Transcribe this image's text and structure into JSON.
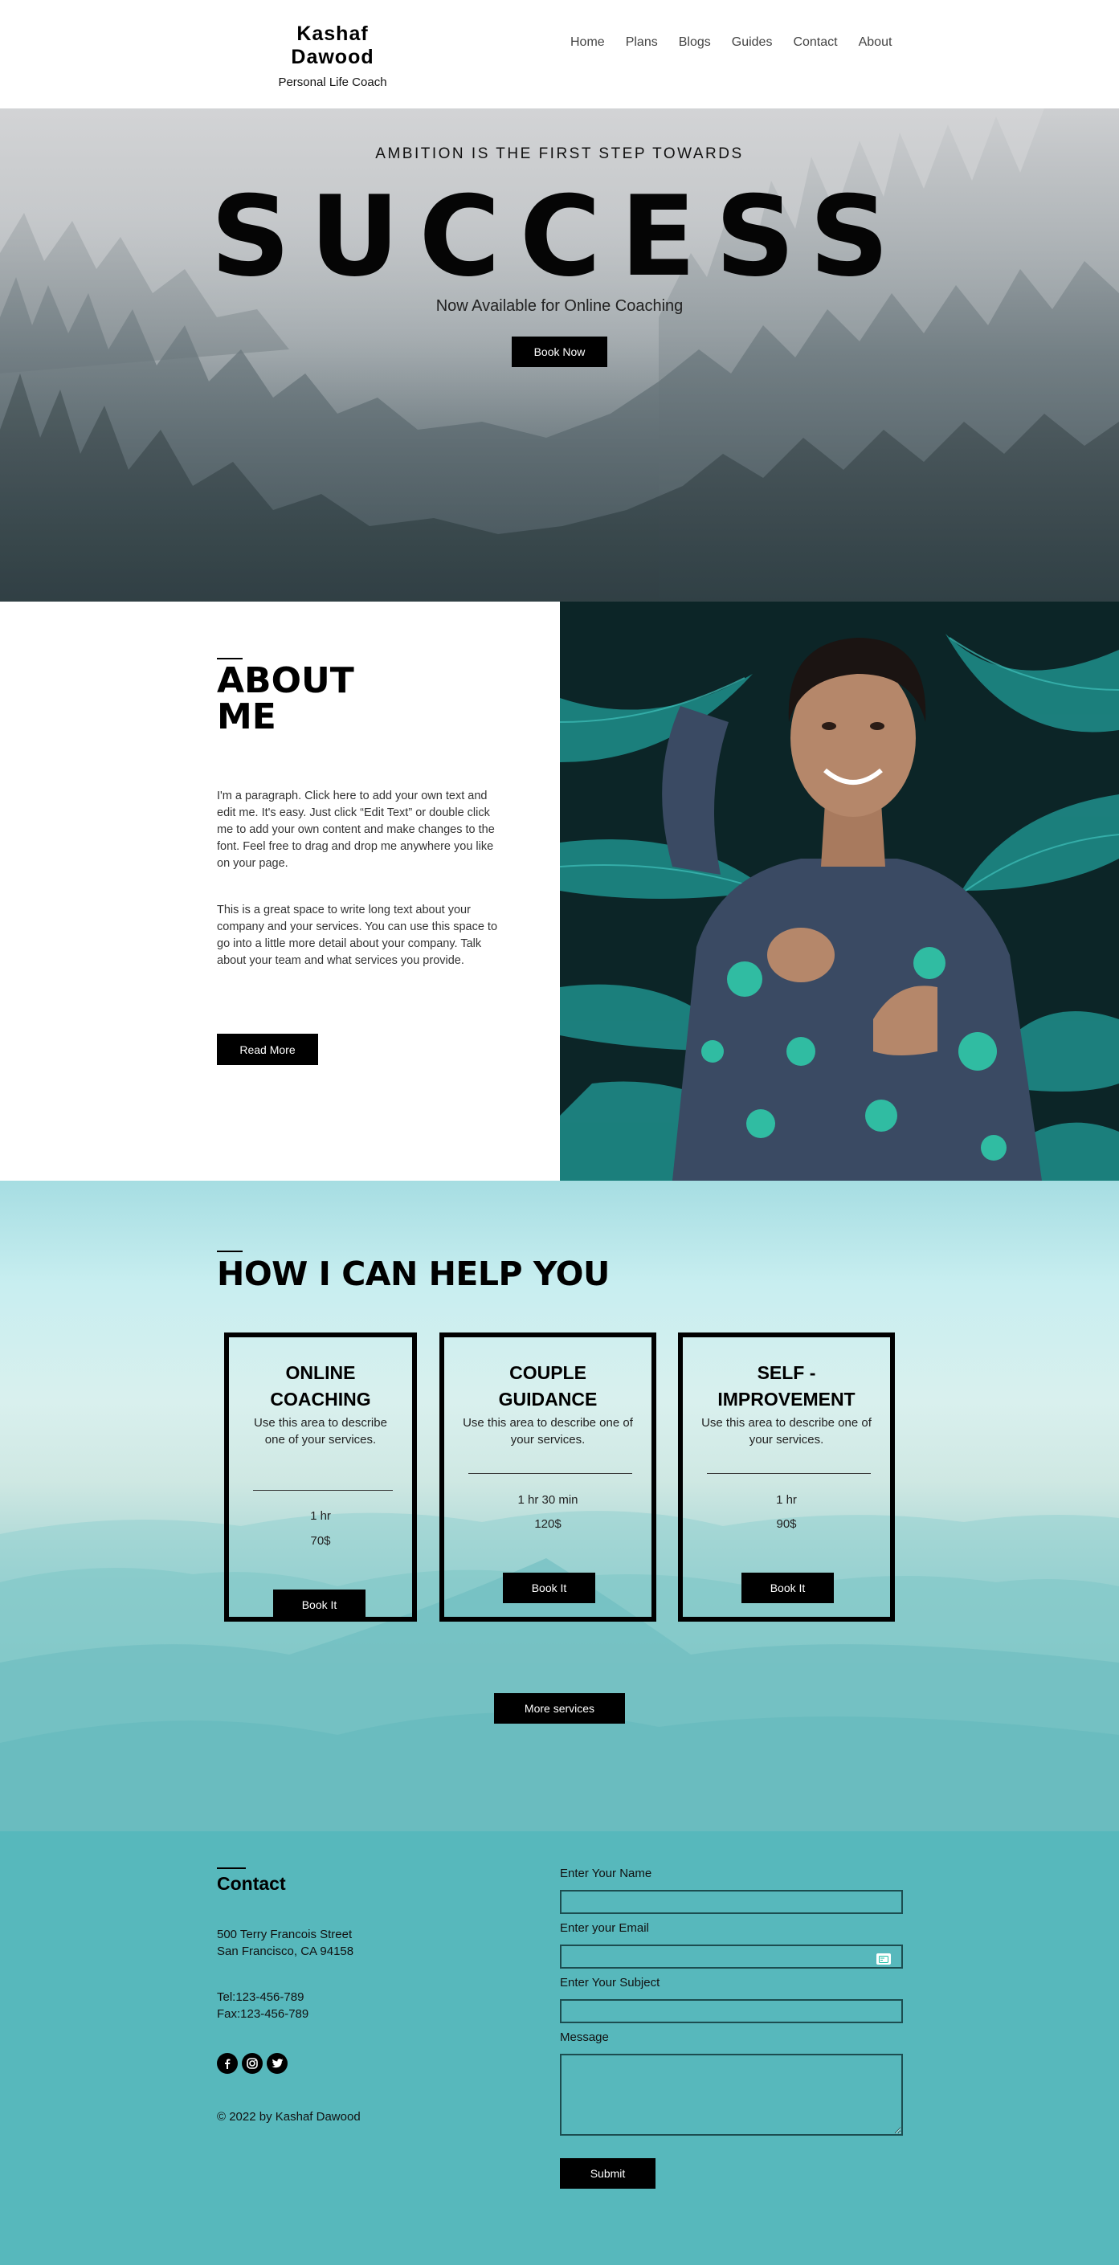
{
  "header": {
    "brand_name": "Kashaf  Dawood",
    "brand_subtitle": "Personal Life Coach",
    "nav": [
      {
        "label": "Home"
      },
      {
        "label": "Plans"
      },
      {
        "label": "Blogs"
      },
      {
        "label": "Guides"
      },
      {
        "label": "Contact"
      },
      {
        "label": "About"
      }
    ]
  },
  "hero": {
    "kicker": "AMBITION  IS  THE  FIRST  STEP  TOWARDS",
    "title": "SUCCESS",
    "subtitle": "Now Available for Online Coaching",
    "button": "Book Now"
  },
  "about": {
    "title_line1": "ABOUT",
    "title_line2": "ME",
    "paragraph1": "I'm a paragraph. Click here to add your own text and edit me. It's easy. Just click “Edit Text” or double click me to add your own content and make changes to the font. Feel free to drag and drop me anywhere you like on your page.",
    "paragraph2": "This is a great space to write long text about your company and your services. You can use this space to go into a little more detail about your company. Talk about your team and what services you provide.",
    "button": "Read More"
  },
  "services": {
    "title": "HOW I CAN HELP YOU",
    "cards": [
      {
        "title_line1": "ONLINE",
        "title_line2": "COACHING",
        "description": "Use this area to describe one of your services.",
        "duration": "1 hr",
        "price": "70$",
        "button": "Book It"
      },
      {
        "title_line1": "COUPLE",
        "title_line2": "GUIDANCE",
        "description": "Use this area to describe one of your services.",
        "duration": "1 hr 30 min",
        "price": "120$",
        "button": "Book It"
      },
      {
        "title_line1": "SELF -",
        "title_line2": "IMPROVEMENT",
        "description": "Use this area to describe one of your services.",
        "duration": "1 hr",
        "price": "90$",
        "button": "Book It"
      }
    ],
    "more_button": "More services"
  },
  "contact": {
    "title": "Contact",
    "address_line1": "500 Terry Francois Street",
    "address_line2": "San Francisco, CA 94158",
    "tel": "Tel:123-456-789",
    "fax": "Fax:123-456-789",
    "social": [
      "facebook-icon",
      "instagram-icon",
      "twitter-icon"
    ],
    "copyright": "© 2022 by Kashaf Dawood",
    "form": {
      "name_label": "Enter Your Name",
      "email_label": "Enter your Email",
      "subject_label": "Enter Your Subject",
      "message_label": "Message",
      "submit": "Submit"
    }
  },
  "colors": {
    "contact_background": "#57b8bc",
    "button_background": "#000000",
    "accent_teal": "#1fbfa6"
  }
}
